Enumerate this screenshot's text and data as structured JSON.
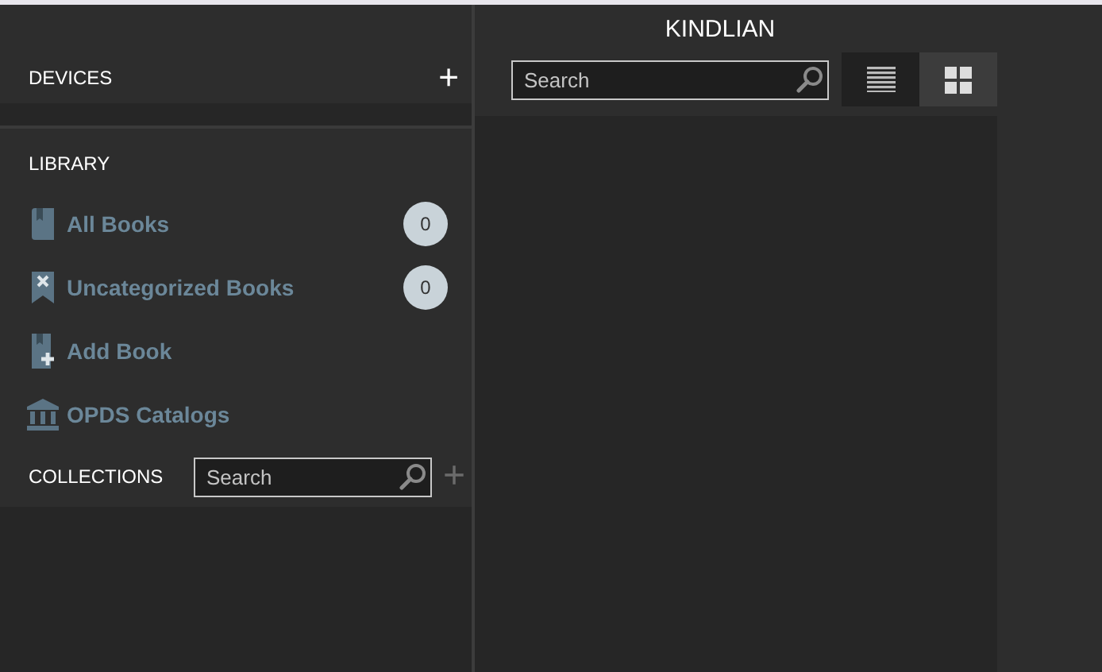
{
  "devices": {
    "title": "DEVICES",
    "add": "+"
  },
  "library": {
    "title": "LIBRARY",
    "items": [
      {
        "kind": "books",
        "label": "All Books",
        "count": "0"
      },
      {
        "kind": "uncategorized",
        "label": "Uncategorized Books",
        "count": "0"
      },
      {
        "kind": "add",
        "label": "Add Book"
      },
      {
        "kind": "catalog",
        "label": "OPDS Catalogs"
      }
    ]
  },
  "collections": {
    "title": "COLLECTIONS",
    "search": {
      "placeholder": "Search"
    },
    "add": "+"
  },
  "window": {
    "title": "KINDLIAN"
  },
  "search": {
    "placeholder": "Search"
  },
  "views": [
    {
      "kind": "list",
      "selected": false
    },
    {
      "kind": "grid",
      "selected": true
    }
  ]
}
